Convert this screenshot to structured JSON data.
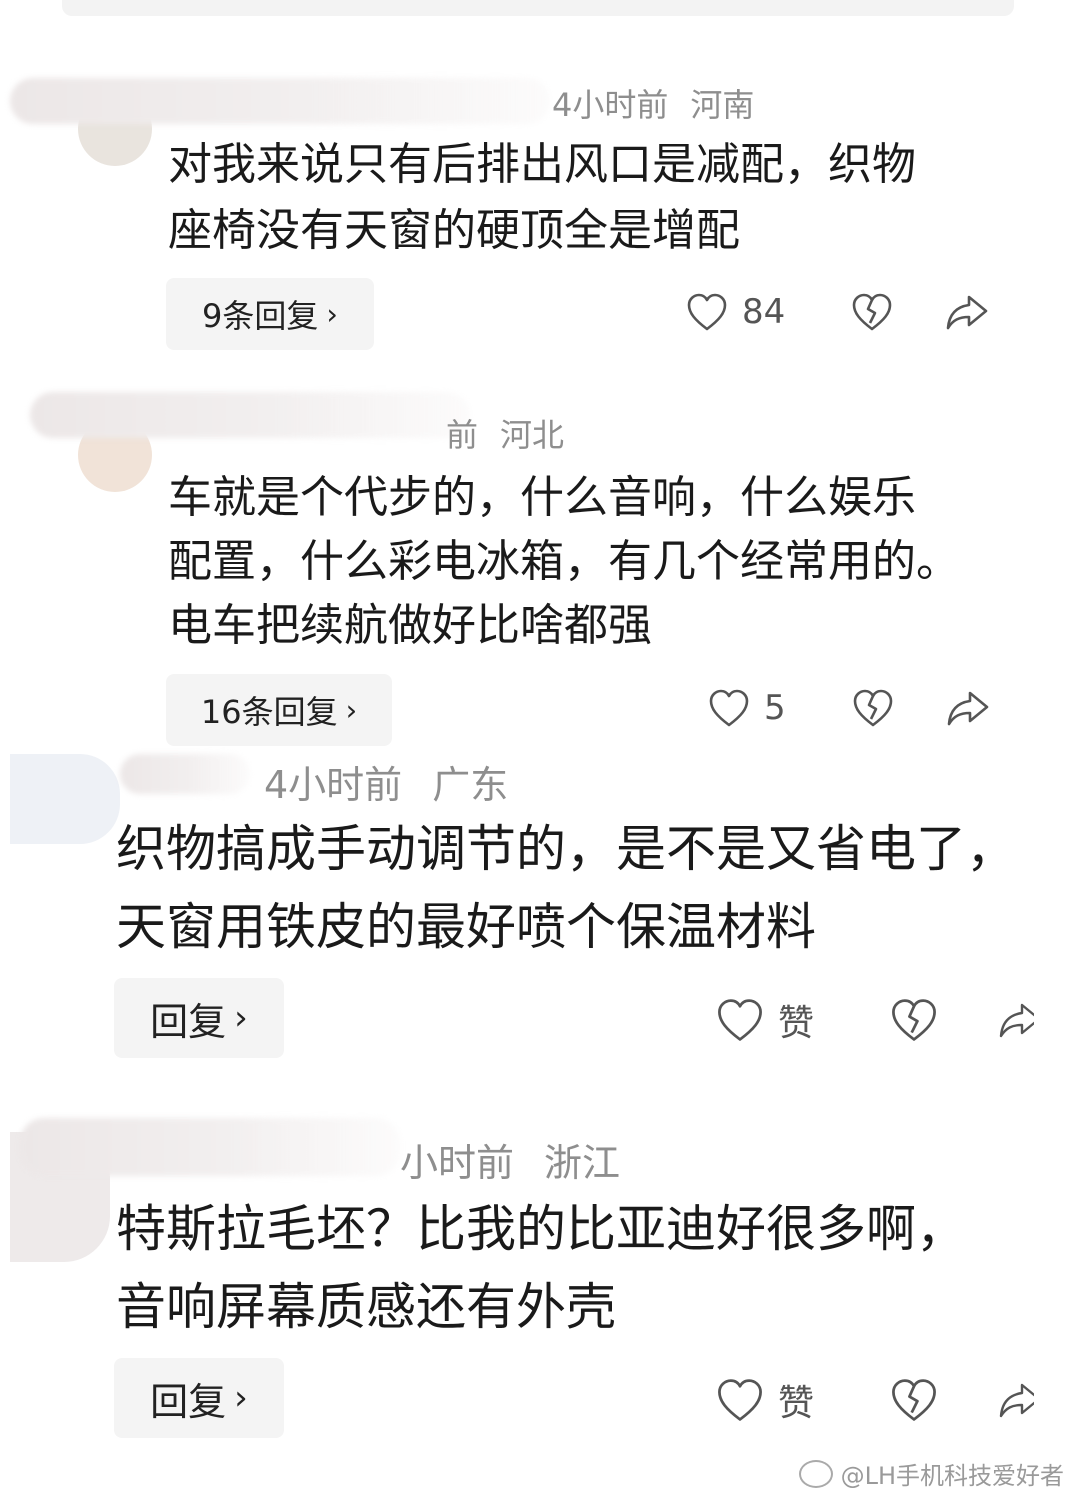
{
  "comments": [
    {
      "meta_time": "4小时前",
      "meta_location": "河南",
      "lines": [
        "对我来说只有后排出风口是减配，织物",
        "座椅没有天窗的硬顶全是增配"
      ],
      "reply_label": "9条回复",
      "like_count": "84"
    },
    {
      "meta_time": "前",
      "meta_location": "河北",
      "lines": [
        "车就是个代步的，什么音响，什么娱乐",
        "配置，什么彩电冰箱，有几个经常用的。",
        "电车把续航做好比啥都强"
      ],
      "reply_label": "16条回复",
      "like_count": "5"
    },
    {
      "meta_time": "4小时前",
      "meta_location": "广东",
      "lines": [
        "织物搞成手动调节的，是不是又省电了，",
        "天窗用铁皮的最好喷个保温材料"
      ],
      "reply_label": "回复",
      "like_count": "赞"
    },
    {
      "meta_time": "小时前",
      "meta_location": "浙江",
      "lines": [
        "特斯拉毛坯？比我的比亚迪好很多啊，",
        "音响屏幕质感还有外壳"
      ],
      "reply_label": "回复",
      "like_count": "赞"
    }
  ],
  "icons": {
    "like": "heart-outline-icon",
    "dislike": "broken-heart-icon",
    "share": "share-arrow-icon",
    "reply_chevron": "chevron-right-icon"
  },
  "watermark": "@LH手机科技爱好者",
  "colors": {
    "meta": "#8e8e8e",
    "text": "#1a1a1a",
    "reply_bg": "#f4f4f4"
  }
}
